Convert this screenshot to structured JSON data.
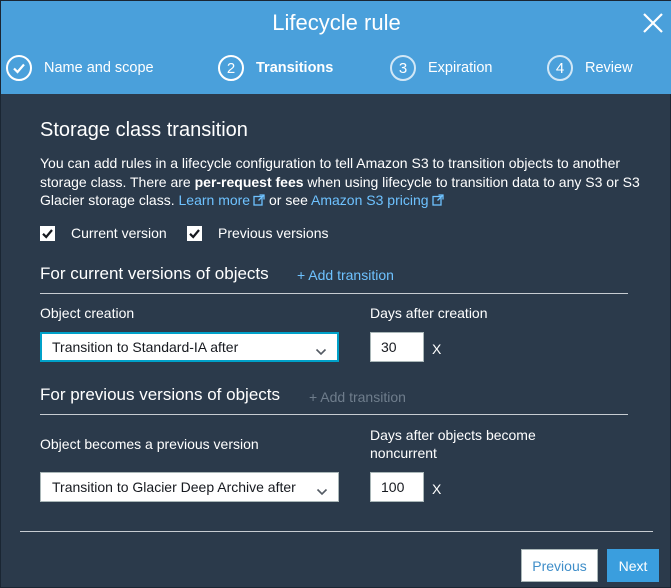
{
  "dialog": {
    "title": "Lifecycle rule"
  },
  "steps": [
    {
      "number": "",
      "label": "Name and scope",
      "state": "done"
    },
    {
      "number": "2",
      "label": "Transitions",
      "state": "active"
    },
    {
      "number": "3",
      "label": "Expiration",
      "state": "pending"
    },
    {
      "number": "4",
      "label": "Review",
      "state": "pending"
    }
  ],
  "section": {
    "title": "Storage class transition",
    "desc_part1": "You can add rules in a lifecycle configuration to tell Amazon S3 to transition objects to another storage class. There are ",
    "desc_bold": "per-request fees",
    "desc_part2": " when using lifecycle to transition data to any S3 or S3 Glacier storage class. ",
    "learn_more": "Learn more",
    "desc_part3": " or see ",
    "pricing_link": "Amazon S3 pricing"
  },
  "checkboxes": [
    {
      "label": "Current version",
      "checked": true
    },
    {
      "label": "Previous versions",
      "checked": true
    }
  ],
  "current_versions": {
    "heading": "For current versions of objects",
    "add_transition": "+ Add transition",
    "object_label": "Object creation",
    "days_label": "Days after creation",
    "select_value": "Transition to Standard-IA after",
    "days_value": "30",
    "unit": "X"
  },
  "previous_versions": {
    "heading": "For previous versions of objects",
    "add_transition": "+ Add transition",
    "object_label": "Object becomes a previous version",
    "days_label": "Days after objects become noncurrent",
    "select_value": "Transition to Glacier Deep Archive after",
    "days_value": "100",
    "unit": "X"
  },
  "footer": {
    "previous_label": "Previous",
    "next_label": "Next"
  },
  "colors": {
    "header": "#4aa0db",
    "body": "#2b3a4b",
    "link": "#6ec2ff",
    "primary_button": "#3a9ede"
  }
}
